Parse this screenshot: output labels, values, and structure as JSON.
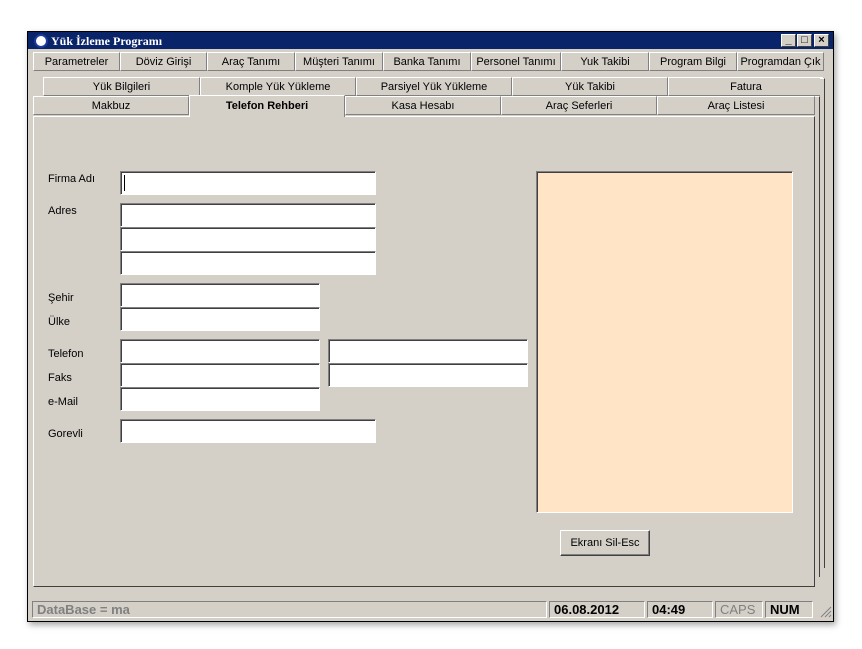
{
  "window": {
    "title": "Yük İzleme Programı"
  },
  "menu_tabs": [
    "Parametreler",
    "Döviz Girişi",
    "Araç Tanımı",
    "Müşteri Tanımı",
    "Banka Tanımı",
    "Personel Tanımı",
    "Yuk Takibi",
    "Program Bilgi",
    "Programdan Çık"
  ],
  "tabs_row2": [
    "Yük Bilgileri",
    "Komple Yük Yükleme",
    "Parsiyel Yük Yükleme",
    "Yük Takibi",
    "Fatura"
  ],
  "tabs_row3": [
    "Makbuz",
    "Telefon Rehberi",
    "Kasa Hesabı",
    "Araç Seferleri",
    "Araç Listesi"
  ],
  "active_tab": "Telefon Rehberi",
  "form": {
    "firma_label": "Firma Adı",
    "adres_label": "Adres",
    "sehir_label": "Şehir",
    "ulke_label": "Ülke",
    "telefon_label": "Telefon",
    "faks_label": "Faks",
    "email_label": "e-Mail",
    "gorevli_label": "Gorevli",
    "clear_button": "Ekranı Sil-Esc"
  },
  "status": {
    "database": "DataBase = ma",
    "date": "06.08.2012",
    "time": "04:49",
    "caps": "CAPS",
    "num": "NUM"
  },
  "colors": {
    "titlebar": "#0a246a",
    "memo_bg": "#ffe4c6",
    "face": "#d4d0c8"
  }
}
